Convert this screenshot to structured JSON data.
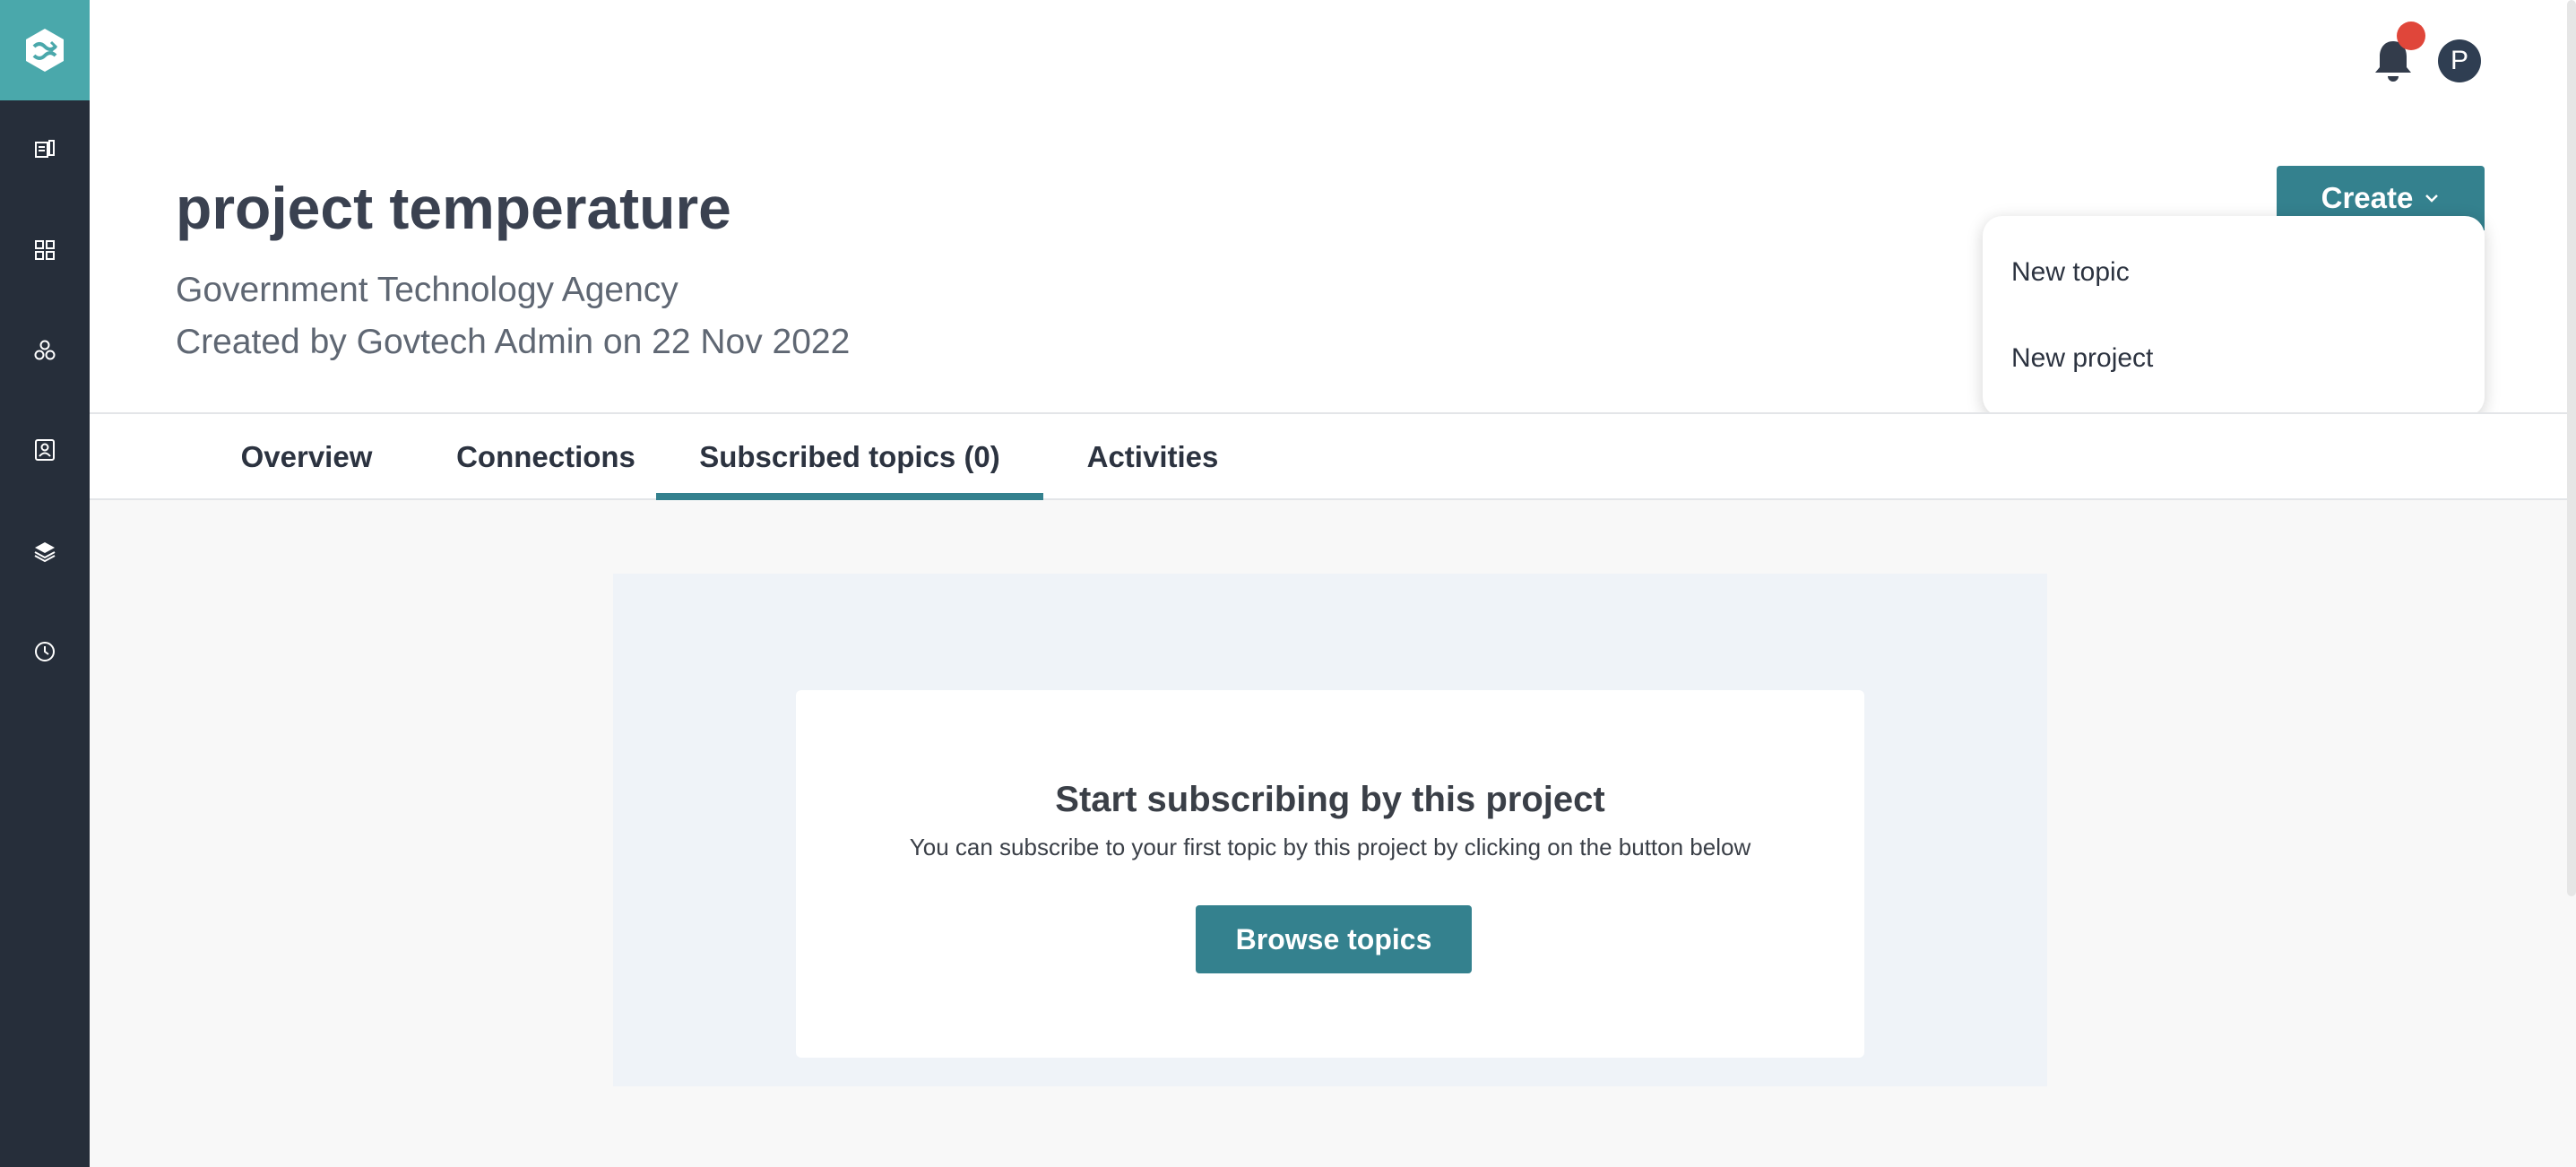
{
  "sidebar": {
    "items": [
      {
        "name": "document-icon"
      },
      {
        "name": "grid-icon"
      },
      {
        "name": "network-icon"
      },
      {
        "name": "contact-card-icon"
      },
      {
        "name": "layers-icon"
      },
      {
        "name": "clock-icon"
      }
    ]
  },
  "header": {
    "avatar_initial": "P"
  },
  "project": {
    "title": "project temperature",
    "organization": "Government Technology Agency",
    "created": "Created by Govtech Admin on 22 Nov 2022"
  },
  "create_menu": {
    "button_label": "Create",
    "items": [
      "New topic",
      "New project"
    ]
  },
  "tabs": [
    {
      "label": "Overview"
    },
    {
      "label": "Connections"
    },
    {
      "label": "Subscribed topics (0)",
      "active": true
    },
    {
      "label": "Activities"
    }
  ],
  "empty_state": {
    "title": "Start subscribing by this project",
    "subtitle": "You can subscribe to your first topic by this project by clicking on the button below",
    "button_label": "Browse topics"
  },
  "colors": {
    "sidebar": "#262e3a",
    "logo_bg": "#4aa8ab",
    "accent": "#34818e",
    "badge": "#e0463a"
  }
}
